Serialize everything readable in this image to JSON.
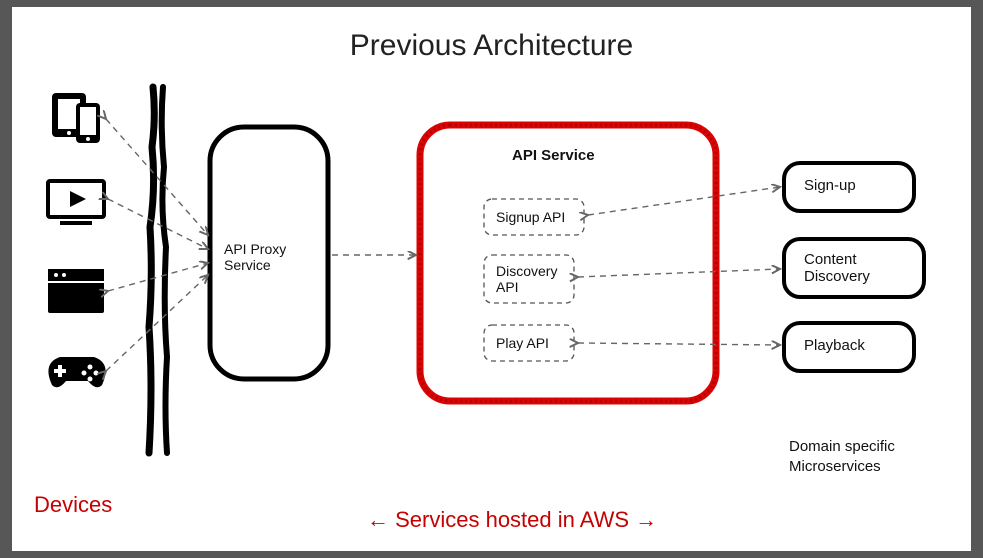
{
  "title": "Previous Architecture",
  "devicesLabel": "Devices",
  "apiProxy": "API Proxy Service",
  "apiService": {
    "title": "API Service",
    "apis": {
      "signup": "Signup API",
      "discovery": "Discovery API",
      "play": "Play API"
    }
  },
  "microservices": {
    "signup": "Sign-up",
    "content": "Content Discovery",
    "playback": "Playback"
  },
  "microservicesCaption": {
    "l1": "Domain specific",
    "l2": "Microservices"
  },
  "awsCaption": "← Services hosted in AWS →",
  "colors": {
    "accent": "#c40202"
  }
}
